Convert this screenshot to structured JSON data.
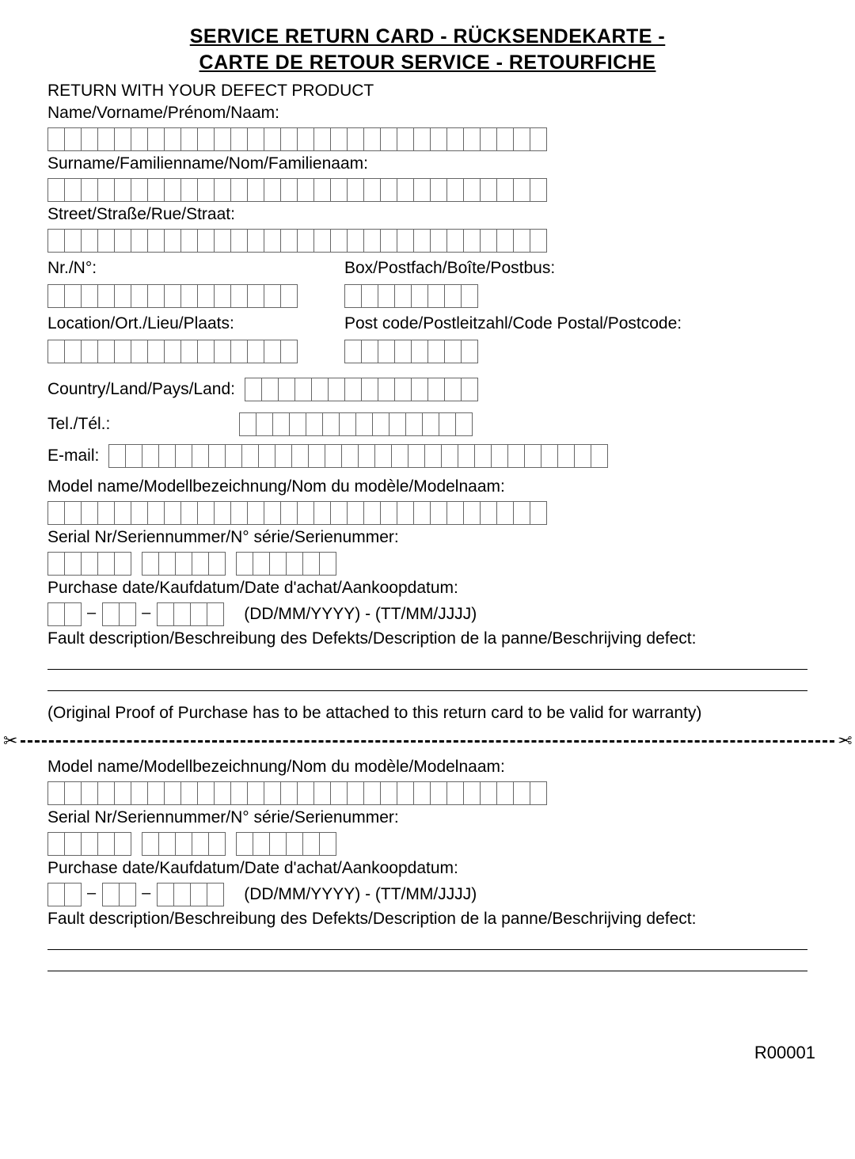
{
  "title_line1": "SERVICE RETURN CARD - RÜCKSENDEKARTE -",
  "title_line2": "CARTE DE RETOUR SERVICE - RETOURFICHE",
  "subhead": "RETURN WITH YOUR DEFECT PRODUCT",
  "labels": {
    "name": "Name/Vorname/Prénom/Naam:",
    "surname": "Surname/Familienname/Nom/Familienaam:",
    "street": "Street/Straße/Rue/Straat:",
    "nr": "Nr./N°:",
    "box": "Box/Postfach/Boîte/Postbus:",
    "location": "Location/Ort./Lieu/Plaats:",
    "postcode": "Post code/Postleitzahl/Code Postal/Postcode:",
    "country": "Country/Land/Pays/Land:",
    "tel": "Tel./Tél.:",
    "email": "E-mail:",
    "model": "Model name/Modellbezeichnung/Nom du modèle/Modelnaam:",
    "serial": "Serial Nr/Seriennummer/N° série/Serienummer:",
    "purchase": "Purchase date/Kaufdatum/Date d'achat/Aankoopdatum:",
    "datehint": "(DD/MM/YYYY) - (TT/MM/JJJJ)",
    "fault": "Fault description/Beschreibung des Defekts/Description de la panne/Beschrijving defect:"
  },
  "note": "(Original Proof of Purchase has to be attached to this return card to be valid for warranty)",
  "footer": "R00001",
  "boxcounts": {
    "name": 30,
    "surname": 30,
    "street": 30,
    "nr": 15,
    "box": 8,
    "location": 15,
    "postcode": 8,
    "country": 14,
    "tel": 14,
    "email": 30,
    "model": 30,
    "serial_groups": [
      5,
      5,
      6
    ],
    "date_dd": 2,
    "date_mm": 2,
    "date_yyyy": 4
  }
}
